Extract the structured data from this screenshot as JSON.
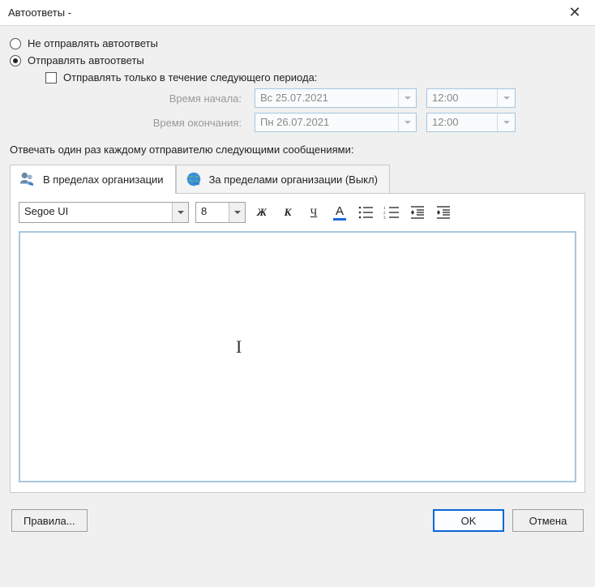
{
  "window": {
    "title": "Автоответы -"
  },
  "radios": {
    "dont_send": "Не отправлять автоответы",
    "send": "Отправлять автоответы"
  },
  "period": {
    "checkbox_label": "Отправлять только в течение следующего периода:",
    "start_label": "Время начала:",
    "end_label": "Время окончания:",
    "start_date": "Вс 25.07.2021",
    "start_time": "12:00",
    "end_date": "Пн 26.07.2021",
    "end_time": "12:00"
  },
  "reply_label": "Отвечать один раз каждому отправителю следующими сообщениями:",
  "tabs": {
    "inside": "В пределах организации",
    "outside": "За пределами организации (Выкл)"
  },
  "toolbar": {
    "font": "Segoe UI",
    "size": "8",
    "bold": "Ж",
    "italic": "К",
    "underline": "Ч",
    "fontcolor_letter": "А"
  },
  "footer": {
    "rules": "Правила...",
    "ok": "OK",
    "cancel": "Отмена"
  }
}
